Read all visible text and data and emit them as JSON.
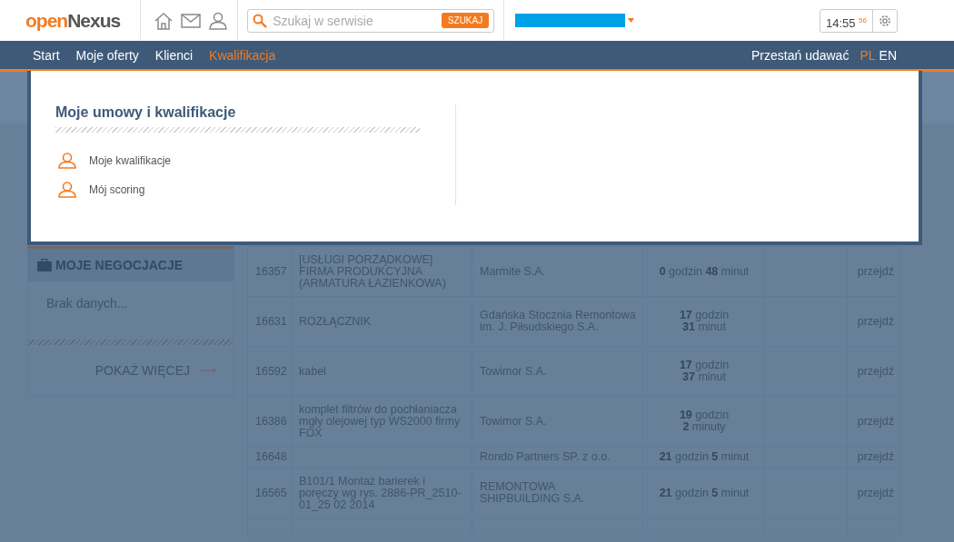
{
  "header": {
    "logo": {
      "part_1": "open",
      "part_2": "Nexus"
    },
    "search": {
      "placeholder": "Szukaj w serwisie",
      "button": "SZUKAJ"
    },
    "clock": {
      "time": "14:55",
      "seconds": "56"
    }
  },
  "nav": {
    "items": [
      {
        "label": "Start",
        "selected": false
      },
      {
        "label": "Moje oferty",
        "selected": false
      },
      {
        "label": "Klienci",
        "selected": false
      },
      {
        "label": "Kwalifikacja",
        "selected": true
      }
    ],
    "right_link": "Przestań udawać",
    "languages": [
      {
        "label": "PL",
        "selected": true
      },
      {
        "label": "EN",
        "selected": false
      }
    ]
  },
  "dropdown": {
    "title": "Moje umowy i kwalifikacje",
    "items": [
      "Moje kwalifikacje",
      "Mój scoring"
    ]
  },
  "negotiations": {
    "title": "MOJE NEGOCJACJE",
    "empty": "Brak danych...",
    "more": "POKAŻ WIĘCEJ"
  },
  "table": {
    "rows": [
      {
        "id": "16357",
        "name": "[USŁUGI PORZĄDKOWE] FIRMA PRODUKCYJNA (ARMATURA ŁAZIENKOWA)",
        "company": "Marmite S.A.",
        "time_lines": [
          "**0** godzin  **48** minut"
        ],
        "link": "przejdź"
      },
      {
        "id": "16631",
        "name": "ROZŁĄCZNIK",
        "company": "Gdańska Stocznia Remontowa im. J. Piłsudskiego S.A.",
        "time_lines": [
          "**17** godzin",
          "**31** minut"
        ],
        "link": "przejdź"
      },
      {
        "id": "16592",
        "name": "kabel",
        "company": "Towimor S.A.",
        "time_lines": [
          "**17** godzin",
          "**37** minut"
        ],
        "link": "przejdź"
      },
      {
        "id": "16386",
        "name": "komplet filtrów do pochłaniacza mgły olejowej typ WS2000 firmy FOX",
        "company": "Towimor S.A.",
        "time_lines": [
          "**19** godzin",
          "**2** minuty"
        ],
        "link": "przejdź"
      },
      {
        "id": "16648",
        "company": "Rondo Partners SP. z o.o.",
        "time_lines": [
          "**21** godzin  **5** minut"
        ],
        "link": "przejdź"
      },
      {
        "id": "16565",
        "name": "B101/1 Montaż barierek i poręczy wg rys. 2886-PR_2510-01_25 02 2014",
        "company": "REMONTOWA SHIPBUILDING S.A.",
        "time_lines": [
          "**21** godzin  **5** minut"
        ],
        "link": "przejdź"
      }
    ]
  }
}
